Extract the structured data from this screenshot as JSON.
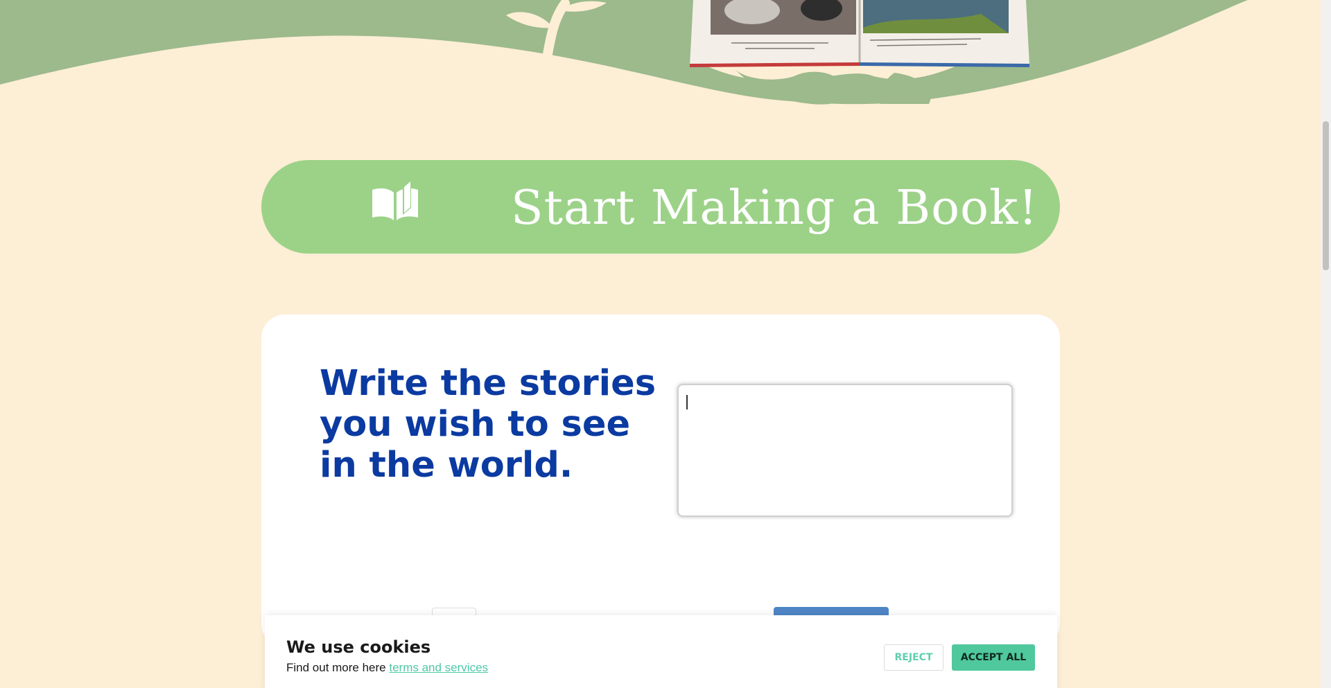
{
  "cta": {
    "label": "Start Making a Book!",
    "icon": "open-book-icon"
  },
  "card": {
    "heading": "Write the stories you wish to see in the world.",
    "story_input_value": ""
  },
  "cookie": {
    "title": "We use cookies",
    "sub_prefix": "Find out more here",
    "link_text": "terms and services",
    "reject_label": "REJECT",
    "accept_label": "ACCEPT ALL"
  },
  "colors": {
    "page_bg": "#fdeed6",
    "hero_green": "#9cba8c",
    "cta_green": "#9cd288",
    "heading_blue": "#0b3aa1",
    "accept_teal": "#4fc89d",
    "link_teal": "#4fc8a6"
  }
}
